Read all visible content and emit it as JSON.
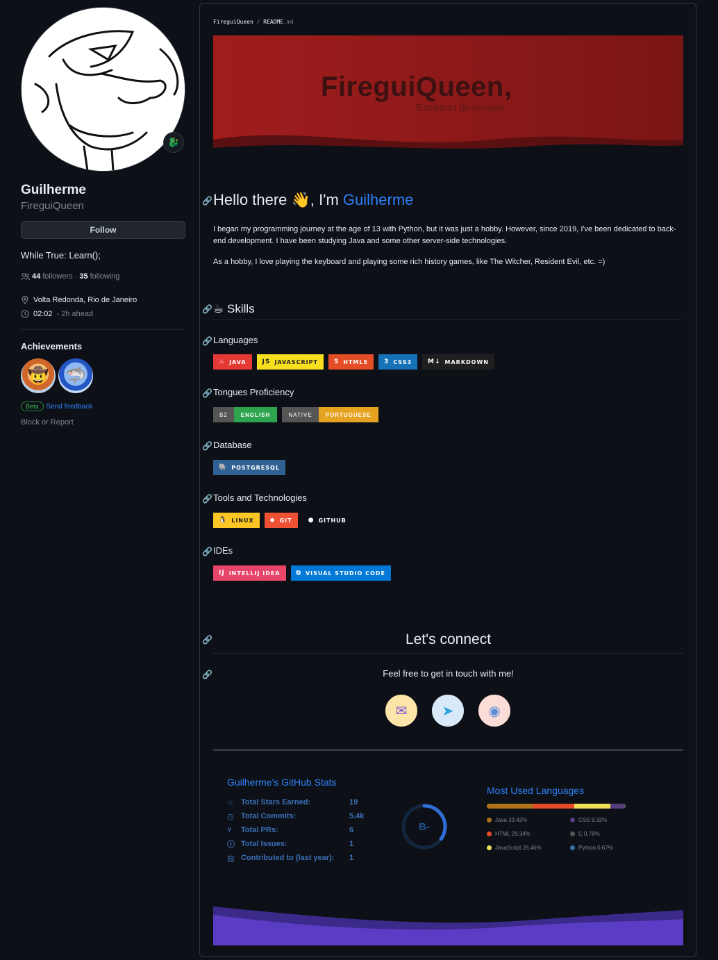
{
  "profile": {
    "name": "Guilherme",
    "login": "FireguiQueen",
    "follow_label": "Follow",
    "bio": "While True: Learn();",
    "followers_count": "44",
    "followers_label": "followers",
    "sep": "·",
    "following_count": "35",
    "following_label": "following",
    "location": "Volta Redonda, Rio de Janeiro",
    "time": "02:02",
    "time_ahead": "- 2h ahead",
    "achievements_title": "Achievements",
    "beta_label": "Beta",
    "feedback_label": "Send feedback",
    "block_label": "Block or Report"
  },
  "readme": {
    "breadcrumb_user": "FireguiQueen",
    "breadcrumb_sep": "/",
    "breadcrumb_file": "README",
    "breadcrumb_ext": ".md",
    "banner_title": "FireguiQueen,",
    "banner_subtitle": "Backend developer",
    "hello_prefix": "Hello there",
    "hello_emoji": "👋",
    "hello_mid": ", I'm",
    "hello_name": "Guilherme",
    "para1": "I began my programming journey at the age of 13 with Python, but it was just a hobby. However, since 2019, I've been dedicated to back-end development. I have been studying Java and some other server-side technologies.",
    "para2": "As a hobby, I love playing the keyboard and playing some rich history games, like The Witcher, Resident Evil, etc. =)",
    "skills_emoji": "☕",
    "skills_title": "Skills",
    "languages_title": "Languages",
    "languages": [
      {
        "label": "JAVA",
        "color": "#e53935",
        "icon": "♨"
      },
      {
        "label": "JAVASCRIPT",
        "color": "#f7df1e",
        "icon": "JS",
        "text_color": "#222"
      },
      {
        "label": "HTML5",
        "color": "#e44d26",
        "icon": "5"
      },
      {
        "label": "CSS3",
        "color": "#1572b6",
        "icon": "3"
      },
      {
        "label": "MARKDOWN",
        "color": "#1f1f1f",
        "icon": "M↓"
      }
    ],
    "tongues_title": "Tongues Proficiency",
    "tongues": [
      {
        "left": "B2",
        "right": "ENGLISH",
        "color": "#2ea44f"
      },
      {
        "left": "NATIVE",
        "right": "PORTUGUESE",
        "color": "#e6a321"
      }
    ],
    "database_title": "Database",
    "database": [
      {
        "label": "POSTGRESQL",
        "color": "#316192",
        "icon": "🐘"
      }
    ],
    "tools_title": "Tools and Technologies",
    "tools": [
      {
        "label": "LINUX",
        "color": "#fcc624",
        "icon": "🐧",
        "text_color": "#222"
      },
      {
        "label": "GIT",
        "color": "#f05033",
        "icon": "◆"
      },
      {
        "label": "GITHUB",
        "color": "#0d1117",
        "icon": "●"
      }
    ],
    "ides_title": "IDEs",
    "ides": [
      {
        "label": "INTELLIJ IDEA",
        "color": "#e8456b",
        "icon": "IJ"
      },
      {
        "label": "VISUAL STUDIO CODE",
        "color": "#0078d7",
        "icon": "⧉"
      }
    ],
    "connect_title": "Let's connect",
    "touch_text": "Feel free to get in touch with me!",
    "socials": [
      {
        "name": "email",
        "icon": "✉",
        "bg": "#fde4a8",
        "fg": "#7d5ad8"
      },
      {
        "name": "telegram",
        "icon": "➤",
        "bg": "#d9e9f9",
        "fg": "#2aa3d9"
      },
      {
        "name": "discord",
        "icon": "◉",
        "bg": "#fbdcd6",
        "fg": "#5a8ed8"
      }
    ]
  },
  "stats": {
    "title": "Guilherme's GitHub Stats",
    "rows": [
      {
        "icon": "☆",
        "label": "Total Stars Earned:",
        "value": "19"
      },
      {
        "icon": "◷",
        "label": "Total Commits:",
        "value": "5.4k"
      },
      {
        "icon": "⑂",
        "label": "Total PRs:",
        "value": "6"
      },
      {
        "icon": "ⓘ",
        "label": "Total Issues:",
        "value": "1"
      },
      {
        "icon": "▤",
        "label": "Contributed to (last year):",
        "value": "1"
      }
    ],
    "grade": "B-",
    "grade_progress": 0.35
  },
  "languages_card": {
    "title": "Most Used Languages",
    "items": [
      {
        "label": "Java 33.42%",
        "pct": 33.42,
        "color": "#b07219"
      },
      {
        "label": "CSS 9.32%",
        "pct": 9.32,
        "color": "#563d7c"
      },
      {
        "label": "HTML 29.34%",
        "pct": 29.34,
        "color": "#e34c26"
      },
      {
        "label": "C 0.78%",
        "pct": 0.78,
        "color": "#555555"
      },
      {
        "label": "JavaScript 26.46%",
        "pct": 26.46,
        "color": "#f1e05a"
      },
      {
        "label": "Python 0.67%",
        "pct": 0.67,
        "color": "#3572A5"
      }
    ]
  }
}
